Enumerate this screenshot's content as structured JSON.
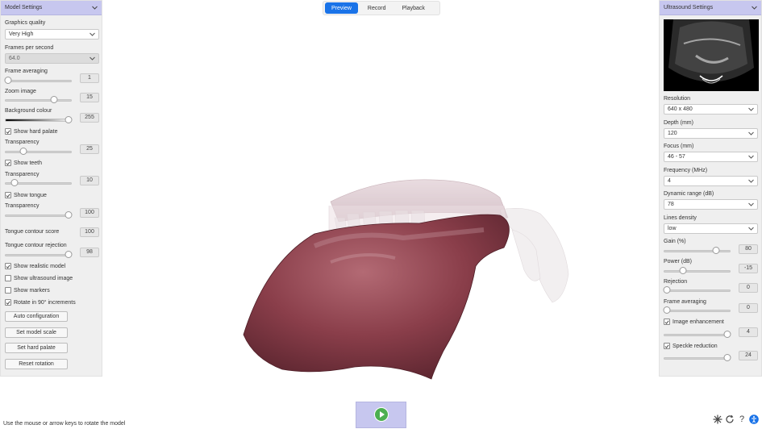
{
  "tabs": [
    {
      "label": "Preview",
      "active": true
    },
    {
      "label": "Record",
      "active": false
    },
    {
      "label": "Playback",
      "active": false
    }
  ],
  "left_panel": {
    "title": "Model Settings",
    "graphics_quality_label": "Graphics quality",
    "graphics_quality_value": "Very High",
    "fps_label": "Frames per second",
    "fps_value": "64.0",
    "frame_averaging_label": "Frame averaging",
    "frame_averaging_value": "1",
    "zoom_label": "Zoom image",
    "zoom_value": "15",
    "background_label": "Background colour",
    "background_value": "255",
    "show_hard_palate": "Show hard palate",
    "hard_palate_transparency_label": "Transparency",
    "hard_palate_transparency_value": "25",
    "show_teeth": "Show teeth",
    "teeth_transparency_label": "Transparency",
    "teeth_transparency_value": "10",
    "show_tongue": "Show tongue",
    "tongue_transparency_label": "Transparency",
    "tongue_transparency_value": "100",
    "contour_score_label": "Tongue contour score",
    "contour_score_value": "100",
    "contour_rejection_label": "Tongue contour rejection",
    "contour_rejection_value": "98",
    "show_realistic_model": "Show realistic model",
    "show_ultrasound_image": "Show ultrasound image",
    "show_markers": "Show markers",
    "rotate_90": "Rotate in 90° increments",
    "btn_auto_config": "Auto configuration",
    "btn_model_scale": "Set model scale",
    "btn_hard_palate": "Set hard palate",
    "btn_reset_rotation": "Reset rotation"
  },
  "right_panel": {
    "title": "Ultrasound Settings",
    "resolution_label": "Resolution",
    "resolution_value": "640 x 480",
    "depth_label": "Depth (mm)",
    "depth_value": "120",
    "focus_label": "Focus (mm)",
    "focus_value": "46 - 57",
    "frequency_label": "Frequency (MHz)",
    "frequency_value": "4",
    "dynamic_range_label": "Dynamic range (dB)",
    "dynamic_range_value": "78",
    "lines_density_label": "Lines density",
    "lines_density_value": "low",
    "gain_label": "Gain (%)",
    "gain_value": "80",
    "power_label": "Power (dB)",
    "power_value": "-15",
    "rejection_label": "Rejection",
    "rejection_value": "0",
    "frame_averaging_label": "Frame averaging",
    "frame_averaging_value": "0",
    "image_enhancement": "Image enhancement",
    "image_enhancement_value": "4",
    "speckle_reduction": "Speckle reduction",
    "speckle_reduction_value": "24"
  },
  "status_text": "Use the mouse or arrow keys to rotate the model",
  "colors": {
    "accent": "#1a73e8",
    "header": "#c7c7ef",
    "panel": "#efefef"
  }
}
